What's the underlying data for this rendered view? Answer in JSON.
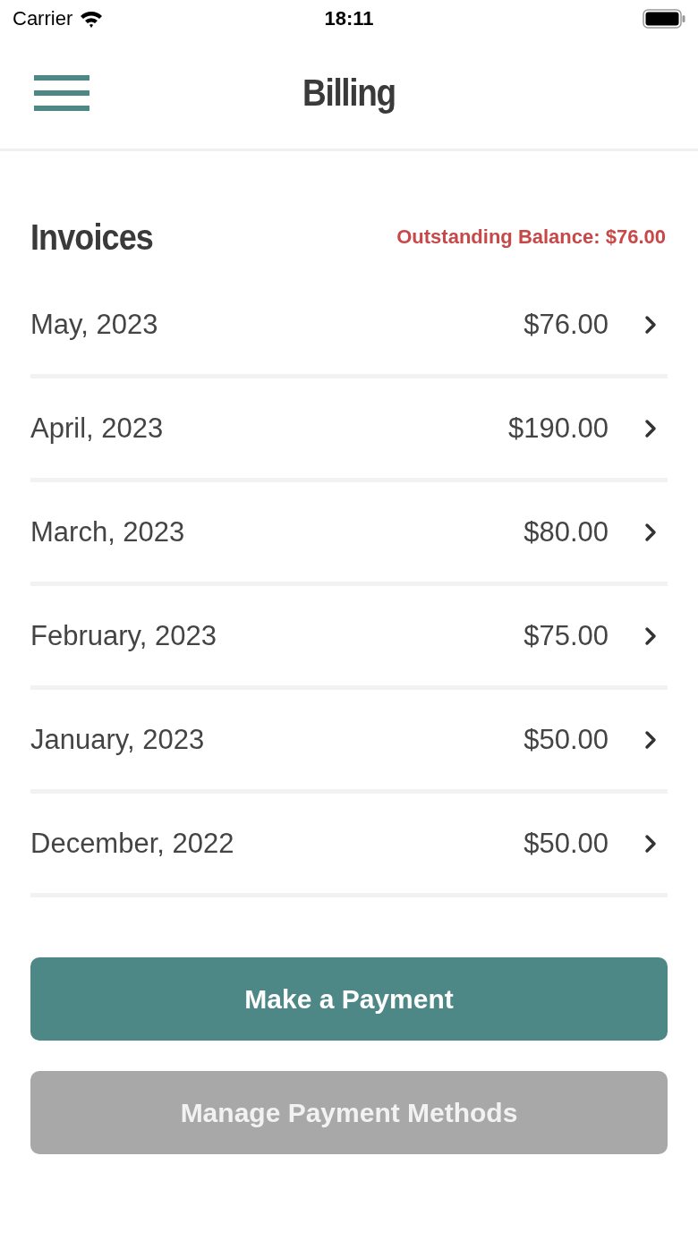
{
  "status_bar": {
    "carrier": "Carrier",
    "time": "18:11"
  },
  "nav_bar": {
    "title": "Billing"
  },
  "invoices": {
    "heading": "Invoices",
    "outstanding_balance": "Outstanding Balance: $76.00",
    "rows": [
      {
        "month": "May, 2023",
        "amount": "$76.00"
      },
      {
        "month": "April, 2023",
        "amount": "$190.00"
      },
      {
        "month": "March, 2023",
        "amount": "$80.00"
      },
      {
        "month": "February, 2023",
        "amount": "$75.00"
      },
      {
        "month": "January, 2023",
        "amount": "$50.00"
      },
      {
        "month": "December, 2022",
        "amount": "$50.00"
      }
    ]
  },
  "buttons": [
    {
      "label": "Make a Payment",
      "disabled": false
    },
    {
      "label": "Manage Payment Methods",
      "disabled": true
    }
  ]
}
